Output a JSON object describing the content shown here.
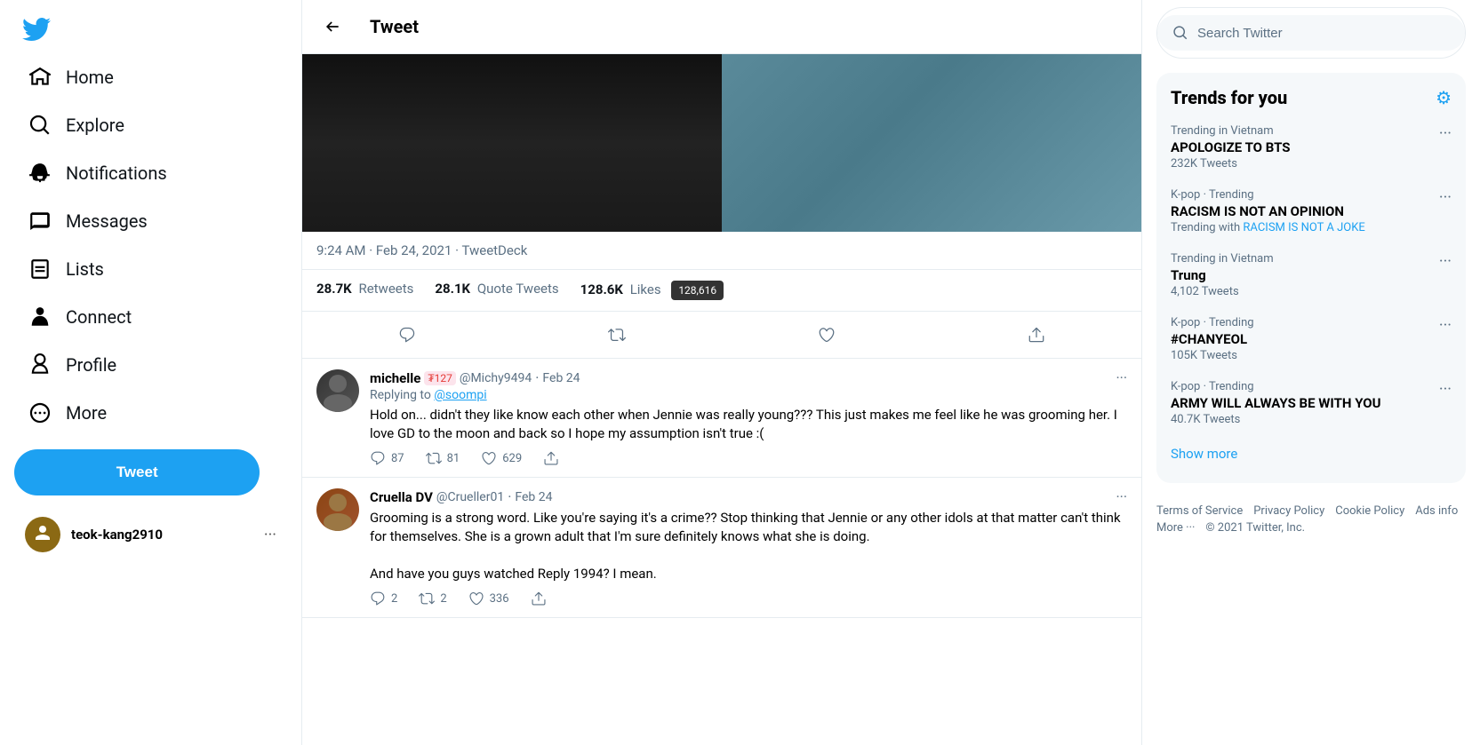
{
  "sidebar": {
    "logo_label": "Twitter",
    "nav_items": [
      {
        "id": "home",
        "label": "Home",
        "icon": "home-icon"
      },
      {
        "id": "explore",
        "label": "Explore",
        "icon": "explore-icon"
      },
      {
        "id": "notifications",
        "label": "Notifications",
        "icon": "notifications-icon"
      },
      {
        "id": "messages",
        "label": "Messages",
        "icon": "messages-icon"
      },
      {
        "id": "lists",
        "label": "Lists",
        "icon": "lists-icon"
      },
      {
        "id": "connect",
        "label": "Connect",
        "icon": "connect-icon"
      },
      {
        "id": "profile",
        "label": "Profile",
        "icon": "profile-icon"
      },
      {
        "id": "more",
        "label": "More",
        "icon": "more-icon"
      }
    ],
    "tweet_button_label": "Tweet",
    "bottom_user": {
      "name": "teok-kang2910",
      "more_label": "···"
    }
  },
  "tweet_detail": {
    "header_title": "Tweet",
    "timestamp": "9:24 AM · Feb 24, 2021 · TweetDeck",
    "stats": {
      "retweets_count": "28.7K",
      "retweets_label": "Retweets",
      "quote_tweets_count": "28.1K",
      "quote_tweets_label": "Quote Tweets",
      "likes_count": "128.6K",
      "likes_label": "Likes",
      "likes_tooltip": "128,616"
    },
    "replies": [
      {
        "id": "reply-1",
        "name": "michelle",
        "badge": "₮127",
        "handle": "@Michy9494",
        "date": "Feb 24",
        "replying_to_label": "Replying to",
        "replying_to_handle": "@soompi",
        "text": "Hold on... didn't they like know each other when Jennie was really young??? This just makes me feel like he was grooming her. I love GD to the moon and back so I hope my assumption isn't true :(",
        "reply_count": "87",
        "retweet_count": "81",
        "like_count": "629"
      },
      {
        "id": "reply-2",
        "name": "Cruella DV",
        "handle": "@Crueller01",
        "date": "Feb 24",
        "text": "Grooming is a strong word. Like you're saying it's a crime?? Stop thinking that Jennie or any other idols at that matter can't think for themselves. She is a grown adult that I'm sure definitely knows what she is doing.\n\nAnd have you guys watched Reply 1994? I mean.",
        "reply_count": "2",
        "retweet_count": "2",
        "like_count": "336"
      }
    ]
  },
  "right_sidebar": {
    "search_placeholder": "Search Twitter",
    "trends_title": "Trends for you",
    "trends": [
      {
        "id": "trend-1",
        "context": "Trending in Vietnam",
        "name": "APOLOGIZE TO BTS",
        "sub": "232K Tweets"
      },
      {
        "id": "trend-2",
        "context": "K-pop · Trending",
        "name": "RACISM IS NOT AN OPINION",
        "sub_prefix": "Trending with",
        "sub_link": "RACISM IS NOT A JOKE"
      },
      {
        "id": "trend-3",
        "context": "Trending in Vietnam",
        "name": "Trung",
        "sub": "4,102 Tweets"
      },
      {
        "id": "trend-4",
        "context": "K-pop · Trending",
        "name": "#CHANYEOL",
        "sub": "105K Tweets"
      },
      {
        "id": "trend-5",
        "context": "K-pop · Trending",
        "name": "ARMY WILL ALWAYS BE WITH YOU",
        "sub": "40.7K Tweets"
      }
    ],
    "show_more_label": "Show more",
    "footer": {
      "terms": "Terms of Service",
      "privacy": "Privacy Policy",
      "cookie": "Cookie Policy",
      "ads_info": "Ads info",
      "more": "More ···",
      "copyright": "© 2021 Twitter, Inc."
    }
  }
}
